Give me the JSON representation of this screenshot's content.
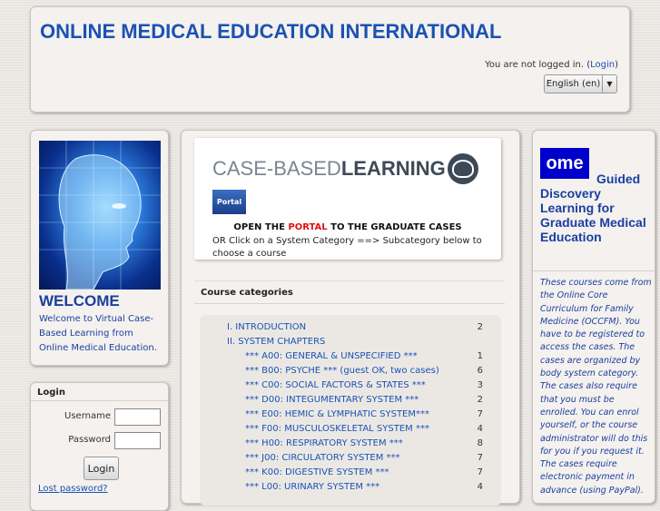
{
  "header": {
    "title": "ONLINE MEDICAL EDUCATION INTERNATIONAL",
    "not_logged_text": "You are not logged in. (",
    "login_link": "Login",
    "close_paren": ")",
    "language": "English (en)"
  },
  "welcome": {
    "heading": "WELCOME",
    "text": "Welcome to Virtual Case-Based Learning from Online Medical Education."
  },
  "login_block": {
    "title": "Login",
    "username_label": "Username",
    "password_label": "Password",
    "login_button": "Login",
    "lost_password": "Lost password?"
  },
  "center": {
    "logo_light": "CASE-BASED",
    "logo_dark": "LEARNING",
    "portal_button": "Portal",
    "open_prefix": "OPEN THE ",
    "open_portal": "PORTAL",
    "open_suffix": " TO THE GRADUATE CASES",
    "subcategory_text": "OR Click on a System Category ==> Subcategory below to choose a course",
    "categories_title": "Course categories",
    "categories": [
      {
        "name": "I. INTRODUCTION",
        "count": "2"
      },
      {
        "name": "II. SYSTEM CHAPTERS",
        "count": ""
      },
      {
        "name": "*** A00: GENERAL & UNSPECIFIED ***",
        "count": "1"
      },
      {
        "name": "*** B00: PSYCHE *** (guest OK, two cases)",
        "count": "6"
      },
      {
        "name": "*** C00: SOCIAL FACTORS & STATES ***",
        "count": "3"
      },
      {
        "name": "*** D00: INTEGUMENTARY SYSTEM ***",
        "count": "2"
      },
      {
        "name": "*** E00: HEMIC & LYMPHATIC SYSTEM***",
        "count": "7"
      },
      {
        "name": "*** F00: MUSCULOSKELETAL SYSTEM ***",
        "count": "4"
      },
      {
        "name": "*** H00: RESPIRATORY SYSTEM ***",
        "count": "8"
      },
      {
        "name": "*** J00: CIRCULATORY SYSTEM ***",
        "count": "7"
      },
      {
        "name": "*** K00: DIGESTIVE SYSTEM ***",
        "count": "7"
      },
      {
        "name": "*** L00: URINARY SYSTEM ***",
        "count": "4"
      }
    ]
  },
  "right": {
    "logo_text": "ome",
    "guided_text": "Guided Discovery Learning for Graduate Medical Education",
    "description": "These courses come from the Online Core Curriculum for Family Medicine (OCCFM). You have to be registered to access the cases. The cases are organized by body system category. The cases also require that you must be enrolled. You can enrol yourself, or the course administrator will do this for you if you request it. The cases require electronic payment in advance (using PayPal)."
  }
}
